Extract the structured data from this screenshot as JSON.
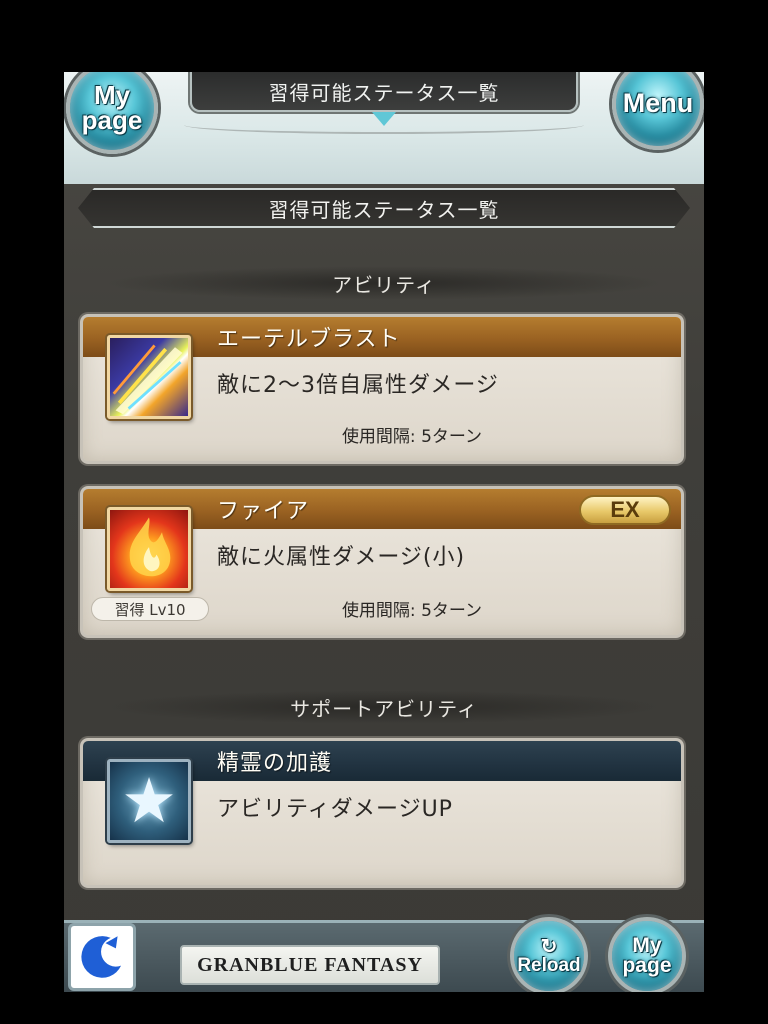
{
  "header": {
    "title": "習得可能ステータス一覧",
    "mypage_label": "My page",
    "menu_label": "Menu"
  },
  "section_title": "習得可能ステータス一覧",
  "categories": {
    "ability": "アビリティ",
    "support": "サポートアビリティ"
  },
  "abilities": [
    {
      "name": "エーテルブラスト",
      "description": "敵に2～3倍自属性ダメージ",
      "cooldown": "使用間隔: 5ターン",
      "icon": "aether-blast-icon"
    },
    {
      "name": "ファイア",
      "description": "敵に火属性ダメージ(小)",
      "cooldown": "使用間隔: 5ターン",
      "badge": "EX",
      "learn_level": "習得 Lv10",
      "icon": "fire-icon"
    }
  ],
  "support_abilities": [
    {
      "name": "精霊の加護",
      "description": "アビリティダメージUP",
      "icon": "star-icon"
    }
  ],
  "footer": {
    "logo_text": "GRANBLUE FANTASY",
    "reload_label": "Reload",
    "mypage_label": "My page",
    "return_icon": "return-icon"
  },
  "colors": {
    "name_bar_gold": "#9a6222",
    "name_bar_navy": "#223442",
    "orb_accent": "#58c6d7"
  }
}
